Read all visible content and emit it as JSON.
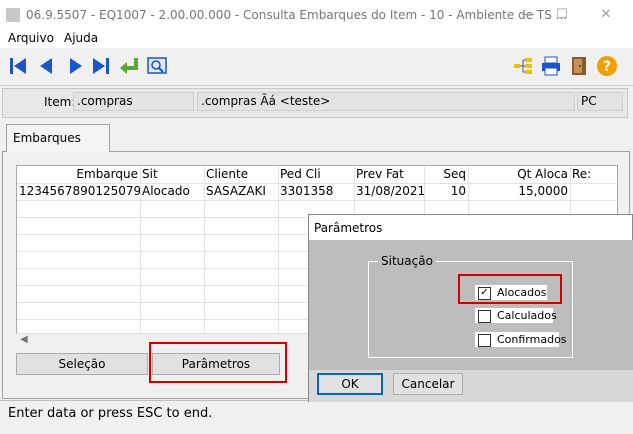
{
  "window": {
    "title": "06.9.5507 - EQ1007 - 2.00.00.000 - Consulta Embarques do Item - 10 - Ambiente de TS ...",
    "controls": [
      "minimize",
      "maximize",
      "close"
    ]
  },
  "menu": {
    "items": [
      "Arquivo",
      "Ajuda"
    ]
  },
  "toolbar": {
    "left_icons": [
      "first-record-icon",
      "previous-record-icon",
      "next-record-icon",
      "last-record-icon",
      "go-to-icon",
      "search-icon"
    ],
    "right_icons": [
      "tree-icon",
      "print-icon",
      "exit-door-icon",
      "help-icon"
    ],
    "help_color": "#f0a000",
    "nav_color": "#1a56c8"
  },
  "item": {
    "label": "Item:",
    "code": ".compras",
    "description": ".compras Ãá <teste>",
    "unit": "PC"
  },
  "tabs": [
    {
      "label": "Embarques"
    }
  ],
  "grid": {
    "columns": [
      "Embarque",
      "Sit",
      "Cliente",
      "Ped Cli",
      "Prev Fat",
      "Seq",
      "Qt Aloca",
      "Re:"
    ],
    "rows": [
      [
        "1234567890125079",
        "Alocado",
        "SASAZAKI",
        "3301358",
        "31/08/2021",
        "10",
        "15,0000",
        ""
      ]
    ]
  },
  "buttons": {
    "selecao": "Seleção",
    "parametros": "Parâmetros"
  },
  "status": {
    "text": "Enter data or press ESC to end."
  },
  "dialog": {
    "title": "Parâmetros",
    "group_label": "Situação",
    "options": [
      {
        "label": "Alocados",
        "checked": true
      },
      {
        "label": "Calculados",
        "checked": false
      },
      {
        "label": "Confirmados",
        "checked": false
      }
    ],
    "ok": "OK",
    "cancel": "Cancelar"
  }
}
